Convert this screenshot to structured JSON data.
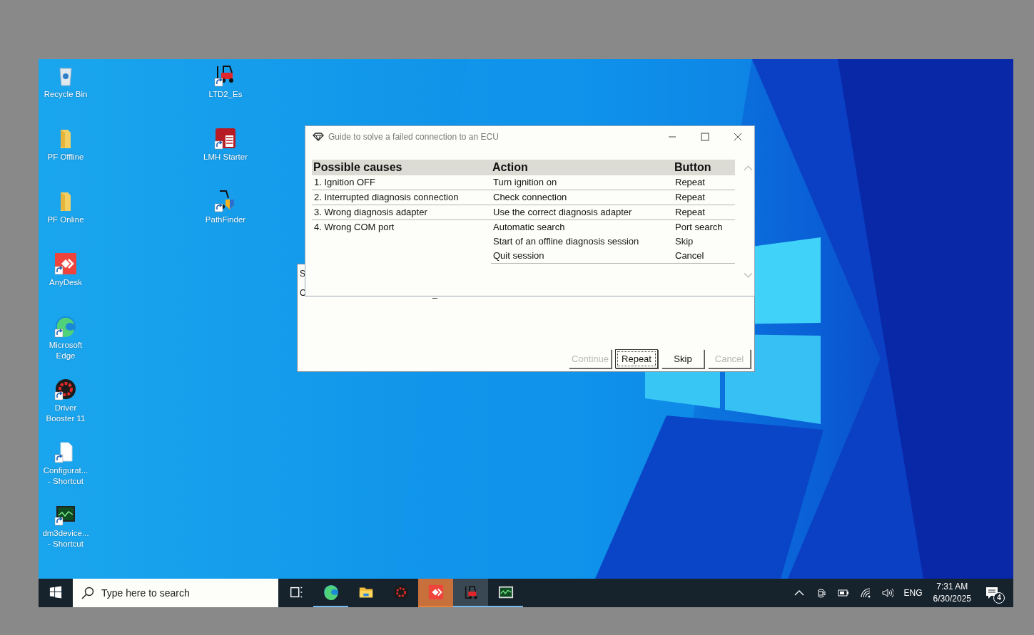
{
  "desktop": {
    "icon_columns": [
      {
        "icons": [
          {
            "kind": "recycle_bin",
            "label": "Recycle Bin",
            "shortcut": false
          },
          {
            "kind": "folder",
            "label": "PF Offline",
            "shortcut": false
          },
          {
            "kind": "folder",
            "label": "PF Online",
            "shortcut": false
          },
          {
            "kind": "anydesk",
            "label": "AnyDesk",
            "shortcut": true
          },
          {
            "kind": "edge",
            "label": "Microsoft Edge",
            "shortcut": true
          },
          {
            "kind": "booster",
            "label": "Driver Booster 11",
            "shortcut": true
          },
          {
            "kind": "document",
            "label": "Configurat... - Shortcut",
            "shortcut": true
          },
          {
            "kind": "monitor",
            "label": "dm3device... - Shortcut",
            "shortcut": true
          }
        ]
      },
      {
        "icons": [
          {
            "kind": "forklift",
            "label": "LTD2_Es",
            "shortcut": true
          },
          {
            "kind": "linde",
            "label": "LMH Starter",
            "shortcut": true
          },
          {
            "kind": "pathfinder",
            "label": "PathFinder",
            "shortcut": true
          }
        ]
      }
    ]
  },
  "dialog": {
    "title": "Guide to solve a failed connection to an ECU",
    "table": {
      "columns": [
        "Possible causes",
        "Action",
        "Button"
      ],
      "rows": [
        {
          "cause": "1. Ignition OFF",
          "actions": [
            {
              "action": "Turn ignition on",
              "button": "Repeat"
            }
          ]
        },
        {
          "cause": "2. Interrupted diagnosis connection",
          "actions": [
            {
              "action": "Check connection",
              "button": "Repeat"
            }
          ]
        },
        {
          "cause": "3. Wrong diagnosis adapter",
          "actions": [
            {
              "action": "Use the correct diagnosis adapter",
              "button": "Repeat"
            }
          ]
        },
        {
          "cause": "4. Wrong COM port",
          "actions": [
            {
              "action": "Automatic search",
              "button": "Port search"
            },
            {
              "action": "Start of an offline diagnosis session",
              "button": "Skip"
            },
            {
              "action": "Quit session",
              "button": "Cancel"
            }
          ]
        }
      ]
    }
  },
  "background_window": {
    "texts": [
      "S",
      "C"
    ],
    "cursor": "_",
    "buttons": [
      {
        "label": "Continue",
        "disabled": true,
        "focused": false
      },
      {
        "label": "Repeat",
        "disabled": false,
        "focused": true
      },
      {
        "label": "Skip",
        "disabled": false,
        "focused": false
      },
      {
        "label": "Cancel",
        "disabled": true,
        "focused": false
      }
    ]
  },
  "taskbar": {
    "search": {
      "placeholder": "Type here to search"
    },
    "apps": [
      {
        "kind": "task_view",
        "running": false,
        "active": false,
        "flashing": false
      },
      {
        "kind": "edge",
        "running": true,
        "active": false,
        "flashing": false
      },
      {
        "kind": "explorer",
        "running": false,
        "active": false,
        "flashing": false
      },
      {
        "kind": "booster",
        "running": false,
        "active": false,
        "flashing": false
      },
      {
        "kind": "anydesk",
        "running": true,
        "active": false,
        "flashing": true
      },
      {
        "kind": "forklift",
        "running": true,
        "active": true,
        "flashing": false
      },
      {
        "kind": "monitor",
        "running": true,
        "active": false,
        "flashing": false
      }
    ],
    "tray": {
      "language": "ENG",
      "time": "7:31 AM",
      "date": "6/30/2025",
      "notifications": "4"
    }
  }
}
